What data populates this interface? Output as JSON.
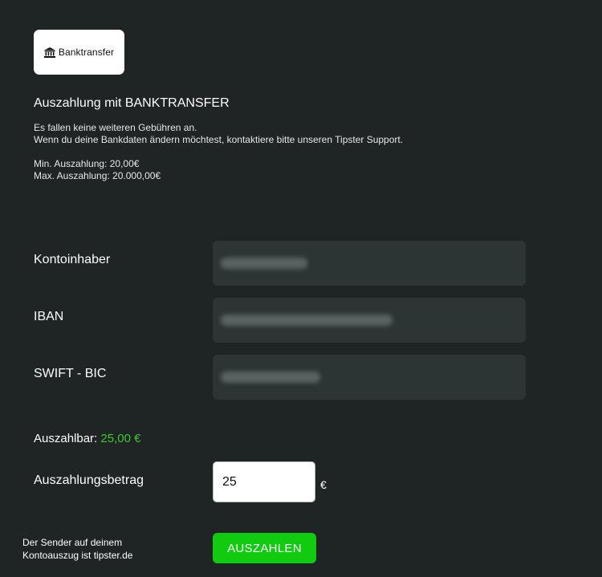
{
  "logo": {
    "icon": "bank-icon",
    "text": "Banktransfer"
  },
  "title": "Auszahlung mit BANKTRANSFER",
  "info": {
    "line1": "Es fallen keine weiteren Gebühren an.",
    "line2": "Wenn du deine Bankdaten ändern möchtest, kontaktiere bitte unseren Tipster Support.",
    "min": "Min. Auszahlung: 20,00€",
    "max": "Max. Auszahlung: 20.000,00€"
  },
  "form": {
    "account_holder_label": "Kontoinhaber",
    "iban_label": "IBAN",
    "bic_label": "SWIFT - BIC"
  },
  "balance": {
    "label": "Auszahlbar:",
    "amount": "25,00 €",
    "amount_color": "#3fc72f"
  },
  "payout": {
    "label": "Auszahlungsbetrag",
    "value": "25",
    "currency": "€",
    "sender_line1": "Der Sender auf deinem",
    "sender_line2": "Kontoauszug ist tipster.de",
    "button_label": "AUSZAHLEN",
    "button_color": "#10cb10"
  },
  "colors": {
    "background": "#1f2424",
    "field_background": "#2c3434"
  }
}
